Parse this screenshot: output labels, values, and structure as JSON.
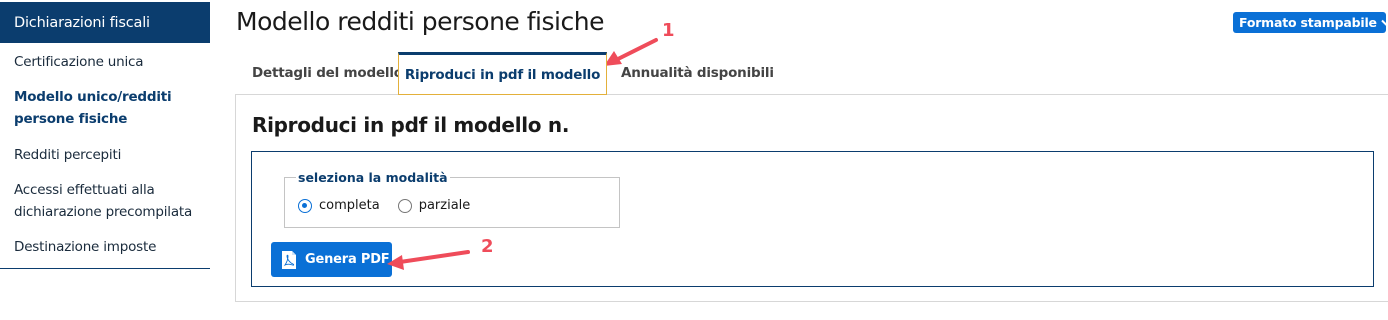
{
  "sidebar": {
    "header": "Dichiarazioni fiscali",
    "items": [
      {
        "label": "Certificazione unica"
      },
      {
        "label_line1": "Modello unico/redditi",
        "label_line2": "persone fisiche"
      },
      {
        "label": "Redditi percepiti"
      },
      {
        "label_line1": "Accessi effettuati alla",
        "label_line2": "dichiarazione precompilata"
      },
      {
        "label": "Destinazione imposte"
      }
    ]
  },
  "header": {
    "title": "Modello redditi persone fisiche",
    "print_button": "Formato stampabile"
  },
  "tabs": [
    {
      "label": "Dettagli del modello"
    },
    {
      "label": "Riproduci in pdf il modello"
    },
    {
      "label": "Annualità disponibili"
    }
  ],
  "panel": {
    "title": "Riproduci in pdf il modello n.",
    "mode_legend": "seleziona la modalità",
    "options": [
      {
        "label": "completa",
        "checked": true
      },
      {
        "label": "parziale",
        "checked": false
      }
    ],
    "generate_button": "Genera PDF"
  },
  "annotations": {
    "marker_1": "1",
    "marker_2": "2",
    "color": "#ef4c5a"
  },
  "colors": {
    "navy": "#0b3d6e",
    "button_blue": "#0a70d6",
    "tab_highlight": "#e3b03a"
  }
}
